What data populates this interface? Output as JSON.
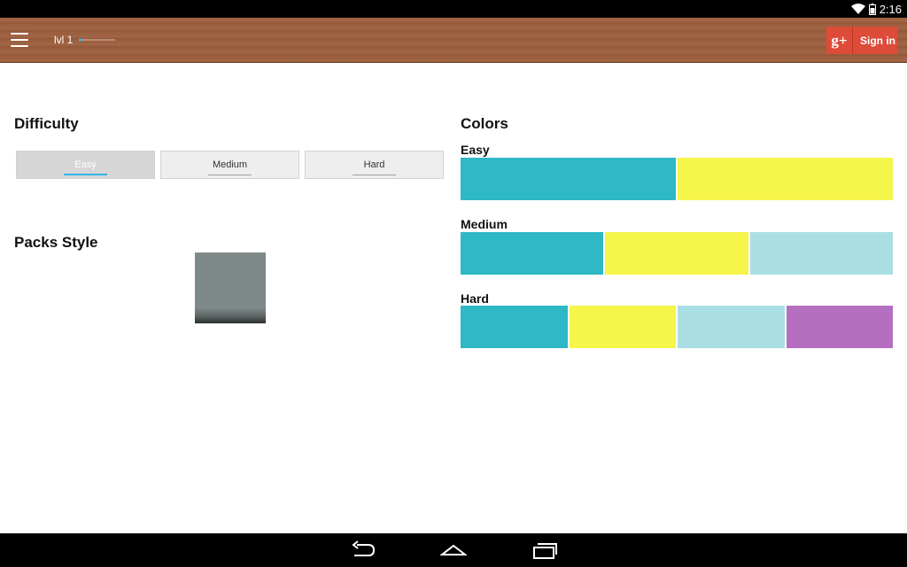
{
  "status": {
    "time": "2:16"
  },
  "appbar": {
    "level_label": "lvl 1",
    "level_progress": 0.05,
    "signin_icon": "g+",
    "signin_label": "Sign in"
  },
  "difficulty": {
    "title": "Difficulty",
    "options": [
      "Easy",
      "Medium",
      "Hard"
    ],
    "selected": "Easy"
  },
  "packs": {
    "title": "Packs Style"
  },
  "colors": {
    "title": "Colors",
    "sets": [
      {
        "label": "Easy",
        "swatches": [
          "#2fb8c6",
          "#f5f54a"
        ]
      },
      {
        "label": "Medium",
        "swatches": [
          "#2fb8c6",
          "#f5f54a",
          "#a9dfe4"
        ]
      },
      {
        "label": "Hard",
        "swatches": [
          "#2fb8c6",
          "#f5f54a",
          "#a9dfe4",
          "#b46fc0"
        ]
      }
    ]
  },
  "theme": {
    "accent": "#33b5e5",
    "google_red": "#dd4b39"
  }
}
